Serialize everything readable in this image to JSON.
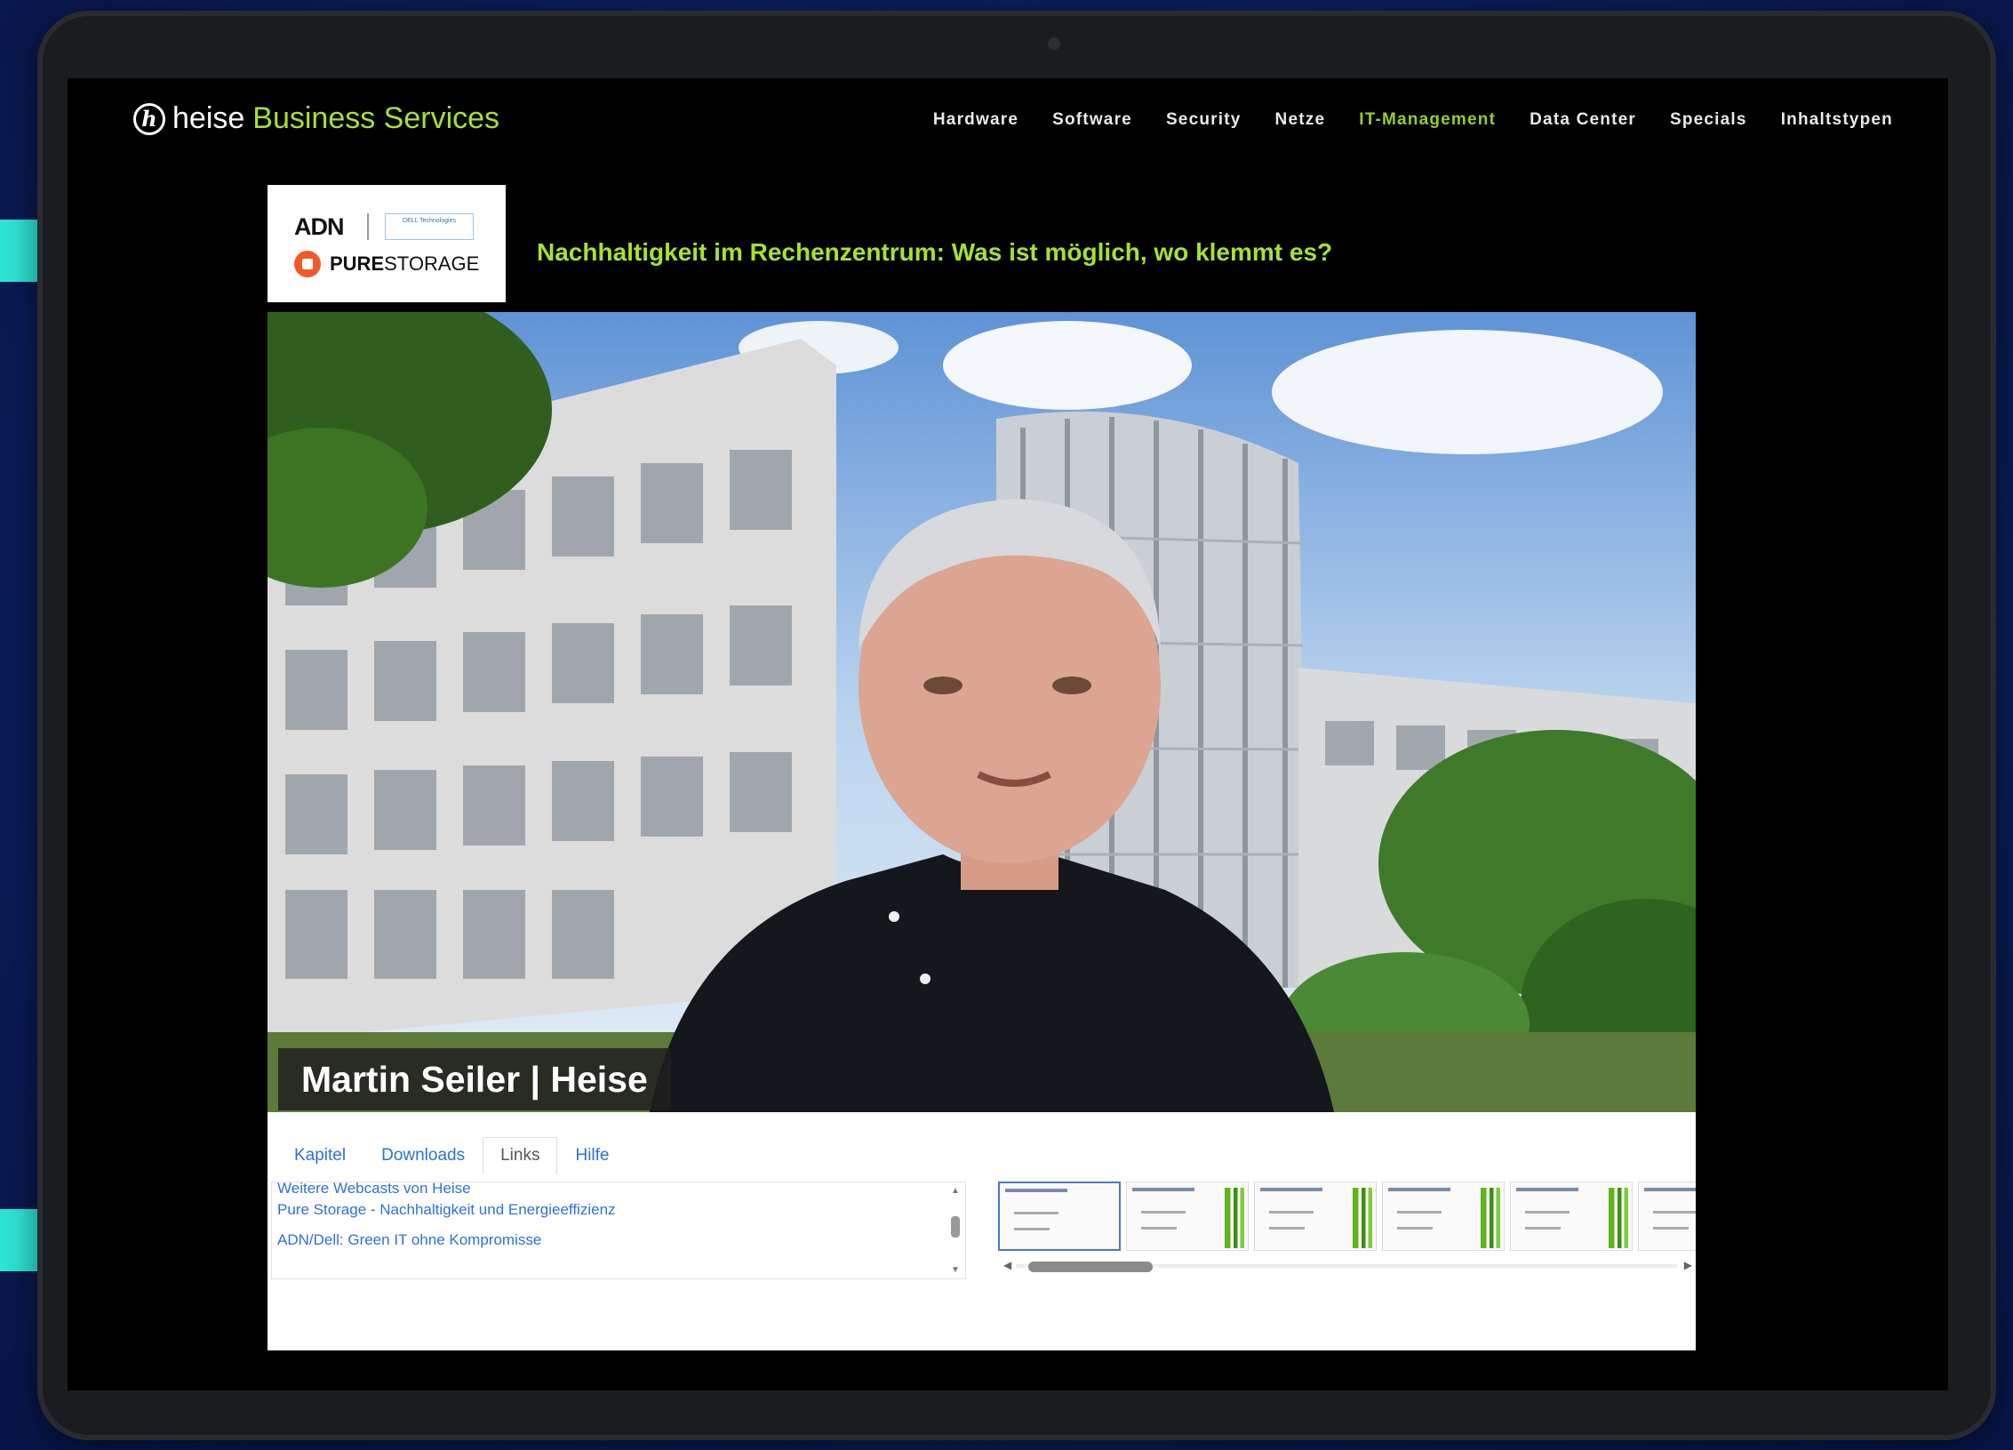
{
  "site": {
    "logo_prefix": "heise",
    "logo_highlight": "Business Services",
    "logo_mark": "h"
  },
  "nav": {
    "items": [
      {
        "label": "Hardware",
        "active": false
      },
      {
        "label": "Software",
        "active": false
      },
      {
        "label": "Security",
        "active": false
      },
      {
        "label": "Netze",
        "active": false
      },
      {
        "label": "IT-Management",
        "active": true
      },
      {
        "label": "Data Center",
        "active": false
      },
      {
        "label": "Specials",
        "active": false
      },
      {
        "label": "Inhaltstypen",
        "active": false
      }
    ]
  },
  "sponsors": {
    "adn": "ADN",
    "dell": "DELL Technologies",
    "pure_bold": "PURE",
    "pure_rest": "STORAGE"
  },
  "webcast": {
    "title": "Nachhaltigkeit im Rechenzentrum: Was ist möglich, wo klemmt es?",
    "speaker_caption": "Martin Seiler | Heise"
  },
  "player": {
    "tabs": [
      {
        "label": "Kapitel",
        "active": false
      },
      {
        "label": "Downloads",
        "active": false
      },
      {
        "label": "Links",
        "active": true
      },
      {
        "label": "Hilfe",
        "active": false
      }
    ],
    "links": [
      "Weitere Webcasts von Heise",
      "Pure Storage - Nachhaltigkeit und Energieeffizienz",
      "ADN/Dell: Green IT ohne Kompromisse"
    ],
    "slides_count": 6
  },
  "colors": {
    "accent_green": "#a6e22e",
    "arrow_cyan": "#2ee6d6",
    "link_blue": "#2f6fe0",
    "background_blue": "#0b1f5c"
  },
  "icons": [
    "arrow-right-icon",
    "heise-logo-icon",
    "pure-storage-icon"
  ]
}
